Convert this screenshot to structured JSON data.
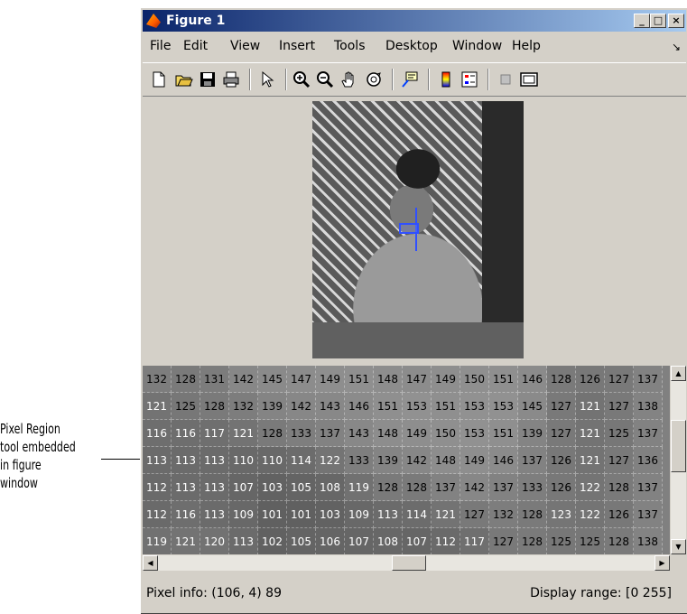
{
  "annotation": {
    "lines": [
      "Pixel Region",
      "tool embedded",
      "in figure",
      "window"
    ]
  },
  "window": {
    "title": "Figure 1",
    "buttons": {
      "minimize": "_",
      "maximize": "□",
      "close": "×"
    }
  },
  "menu": {
    "items": [
      "File",
      "Edit",
      "View",
      "Insert",
      "Tools",
      "Desktop",
      "Window",
      "Help"
    ],
    "dock_glyph": "↘"
  },
  "toolbar": {
    "icons": [
      "new-figure-icon",
      "open-icon",
      "save-icon",
      "print-icon",
      "edit-plot-icon",
      "zoom-in-icon",
      "zoom-out-icon",
      "pan-icon",
      "rotate-3d-icon",
      "data-cursor-icon",
      "colorbar-icon",
      "legend-icon",
      "hide-plot-tools-icon",
      "show-plot-tools-icon"
    ]
  },
  "pixel_region": {
    "rows": [
      [
        "132",
        "128",
        "131",
        "142",
        "145",
        "147",
        "149",
        "151",
        "148",
        "147",
        "149",
        "150",
        "151",
        "146",
        "128",
        "126",
        "127",
        "137"
      ],
      [
        "121",
        "125",
        "128",
        "132",
        "139",
        "142",
        "143",
        "146",
        "151",
        "153",
        "151",
        "153",
        "153",
        "145",
        "127",
        "121",
        "127",
        "138"
      ],
      [
        "116",
        "116",
        "117",
        "121",
        "128",
        "133",
        "137",
        "143",
        "148",
        "149",
        "150",
        "153",
        "151",
        "139",
        "127",
        "121",
        "125",
        "137"
      ],
      [
        "113",
        "113",
        "113",
        "110",
        "110",
        "114",
        "122",
        "133",
        "139",
        "142",
        "148",
        "149",
        "146",
        "137",
        "126",
        "121",
        "127",
        "136"
      ],
      [
        "112",
        "113",
        "113",
        "107",
        "103",
        "105",
        "108",
        "119",
        "128",
        "128",
        "137",
        "142",
        "137",
        "133",
        "126",
        "122",
        "128",
        "137"
      ],
      [
        "112",
        "116",
        "113",
        "109",
        "101",
        "101",
        "103",
        "109",
        "113",
        "114",
        "121",
        "127",
        "132",
        "128",
        "123",
        "122",
        "126",
        "137"
      ],
      [
        "119",
        "121",
        "120",
        "113",
        "102",
        "105",
        "106",
        "107",
        "108",
        "107",
        "112",
        "117",
        "127",
        "128",
        "125",
        "125",
        "128",
        "138"
      ]
    ]
  },
  "status": {
    "pixel_info": "Pixel info: (106, 4)  89",
    "display_range": "Display range: [0 255]"
  }
}
